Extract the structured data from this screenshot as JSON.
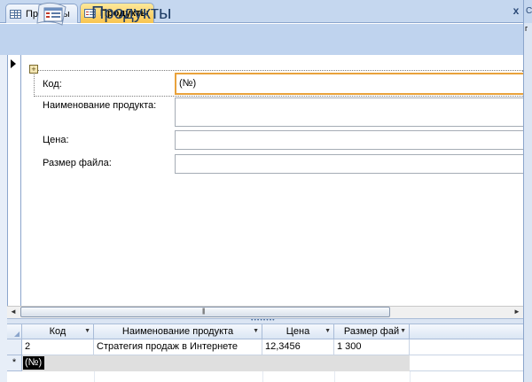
{
  "tabs": [
    {
      "label": "Продукты",
      "icon": "table-icon",
      "active": false
    },
    {
      "label": "Продукты",
      "icon": "form-icon",
      "active": true
    }
  ],
  "close_glyph": "x",
  "right_panel": {
    "top_letter": "С",
    "mark": "г"
  },
  "form": {
    "title": "Продукты",
    "layout_selector_glyph": "+",
    "fields": {
      "code": {
        "label": "Код:",
        "value": "(№)"
      },
      "name": {
        "label": "Наименование продукта:",
        "value": ""
      },
      "price": {
        "label": "Цена:",
        "value": ""
      },
      "size": {
        "label": "Размер файла:",
        "value": ""
      }
    }
  },
  "scrollbar": {
    "left": "◄",
    "right": "►",
    "grip": "|||"
  },
  "splitter_grip": "••••••••",
  "datasheet": {
    "columns": [
      "Код",
      "Наименование продукта",
      "Цена",
      "Размер фай"
    ],
    "dropdown_glyph": "▼",
    "rows": [
      [
        "2",
        "Стратегия продаж в Интернете",
        "12,3456",
        "1 300"
      ]
    ],
    "new_row": {
      "selector": "*",
      "code": "(№)"
    }
  },
  "colors": {
    "header_band": "#bfd3ee",
    "active_tab": "#f9c550",
    "focus_border": "#e9a23b",
    "title_text": "#1f3d66"
  }
}
